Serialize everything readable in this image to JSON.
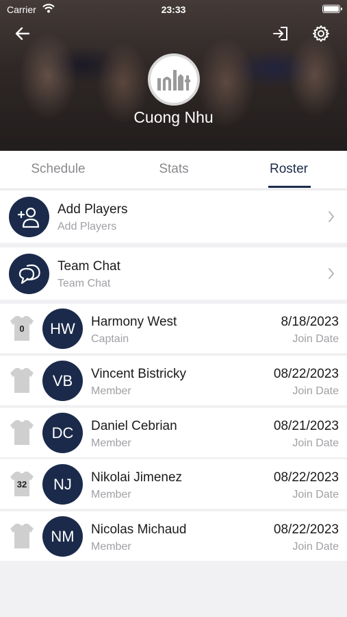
{
  "status_bar": {
    "carrier": "Carrier",
    "time": "23:33"
  },
  "team": {
    "name": "Cuong Nhu"
  },
  "tabs": [
    {
      "label": "Schedule",
      "active": false
    },
    {
      "label": "Stats",
      "active": false
    },
    {
      "label": "Roster",
      "active": true
    }
  ],
  "actions": [
    {
      "title": "Add Players",
      "subtitle": "Add Players",
      "icon": "add-person-icon"
    },
    {
      "title": "Team Chat",
      "subtitle": "Team Chat",
      "icon": "chat-bubble-icon"
    }
  ],
  "roster": [
    {
      "jersey": "0",
      "initials": "HW",
      "name": "Harmony West",
      "role": "Captain",
      "date": "8/18/2023",
      "date_label": "Join Date"
    },
    {
      "jersey": "",
      "initials": "VB",
      "name": "Vincent Bistricky",
      "role": "Member",
      "date": "08/22/2023",
      "date_label": "Join Date"
    },
    {
      "jersey": "",
      "initials": "DC",
      "name": "Daniel Cebrian",
      "role": "Member",
      "date": "08/21/2023",
      "date_label": "Join Date"
    },
    {
      "jersey": "32",
      "initials": "NJ",
      "name": "Nikolai Jimenez",
      "role": "Member",
      "date": "08/22/2023",
      "date_label": "Join Date"
    },
    {
      "jersey": "",
      "initials": "NM",
      "name": "Nicolas Michaud",
      "role": "Member",
      "date": "08/22/2023",
      "date_label": "Join Date"
    }
  ],
  "colors": {
    "accent": "#1b2a4a",
    "muted_text": "#a0a0a5",
    "background": "#f1f1f3"
  }
}
